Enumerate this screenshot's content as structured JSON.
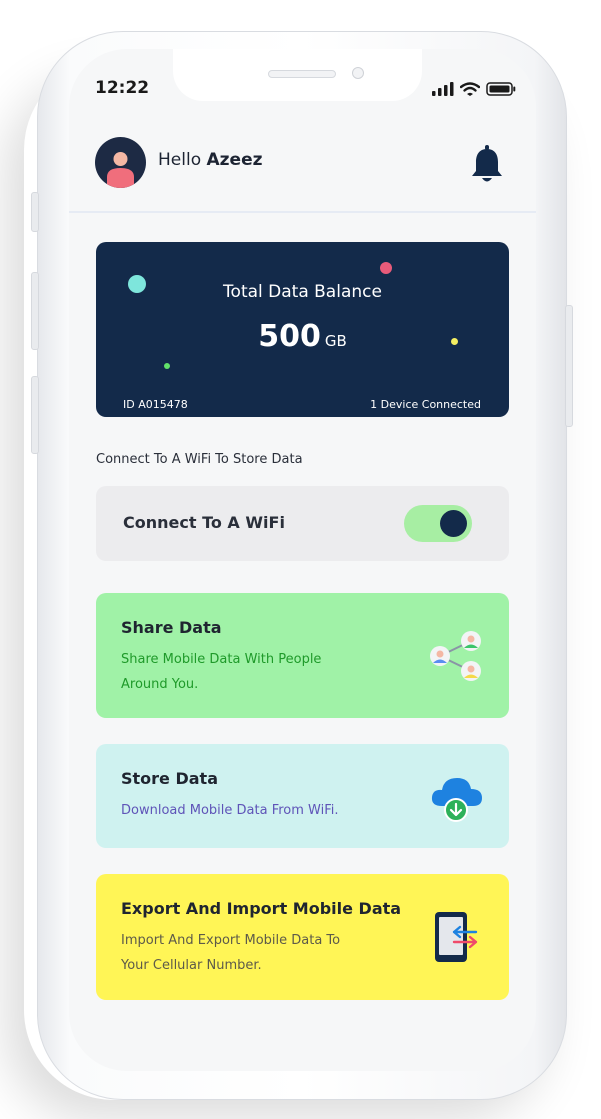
{
  "status_bar": {
    "time": "12:22"
  },
  "header": {
    "greeting": "Hello",
    "user_name": "Azeez"
  },
  "balance_card": {
    "title": "Total Data Balance",
    "amount": "500",
    "unit": "GB",
    "id_label": "ID A015478",
    "devices_label": "1 Device Connected"
  },
  "wifi_section": {
    "label": "Connect To A WiFi To Store Data",
    "toggle_label": "Connect To A WiFi",
    "toggle_on": true
  },
  "cards": {
    "share": {
      "title": "Share Data",
      "desc_line1": "Share Mobile Data With People",
      "desc_line2": "Around You.",
      "icon": "share-people-icon"
    },
    "store": {
      "title": "Store Data",
      "desc_line1": "Download Mobile Data From WiFi.",
      "icon": "cloud-download-icon"
    },
    "export": {
      "title": "Export And Import Mobile Data",
      "desc_line1": "Import And Export Mobile Data To",
      "desc_line2": "Your Cellular Number.",
      "icon": "phone-transfer-icon"
    }
  },
  "colors": {
    "navy": "#132a4a",
    "share_bg": "#a0f2a7",
    "store_bg": "#cff2f0",
    "export_bg": "#fff556",
    "toggle_on": "#a7eea3"
  }
}
